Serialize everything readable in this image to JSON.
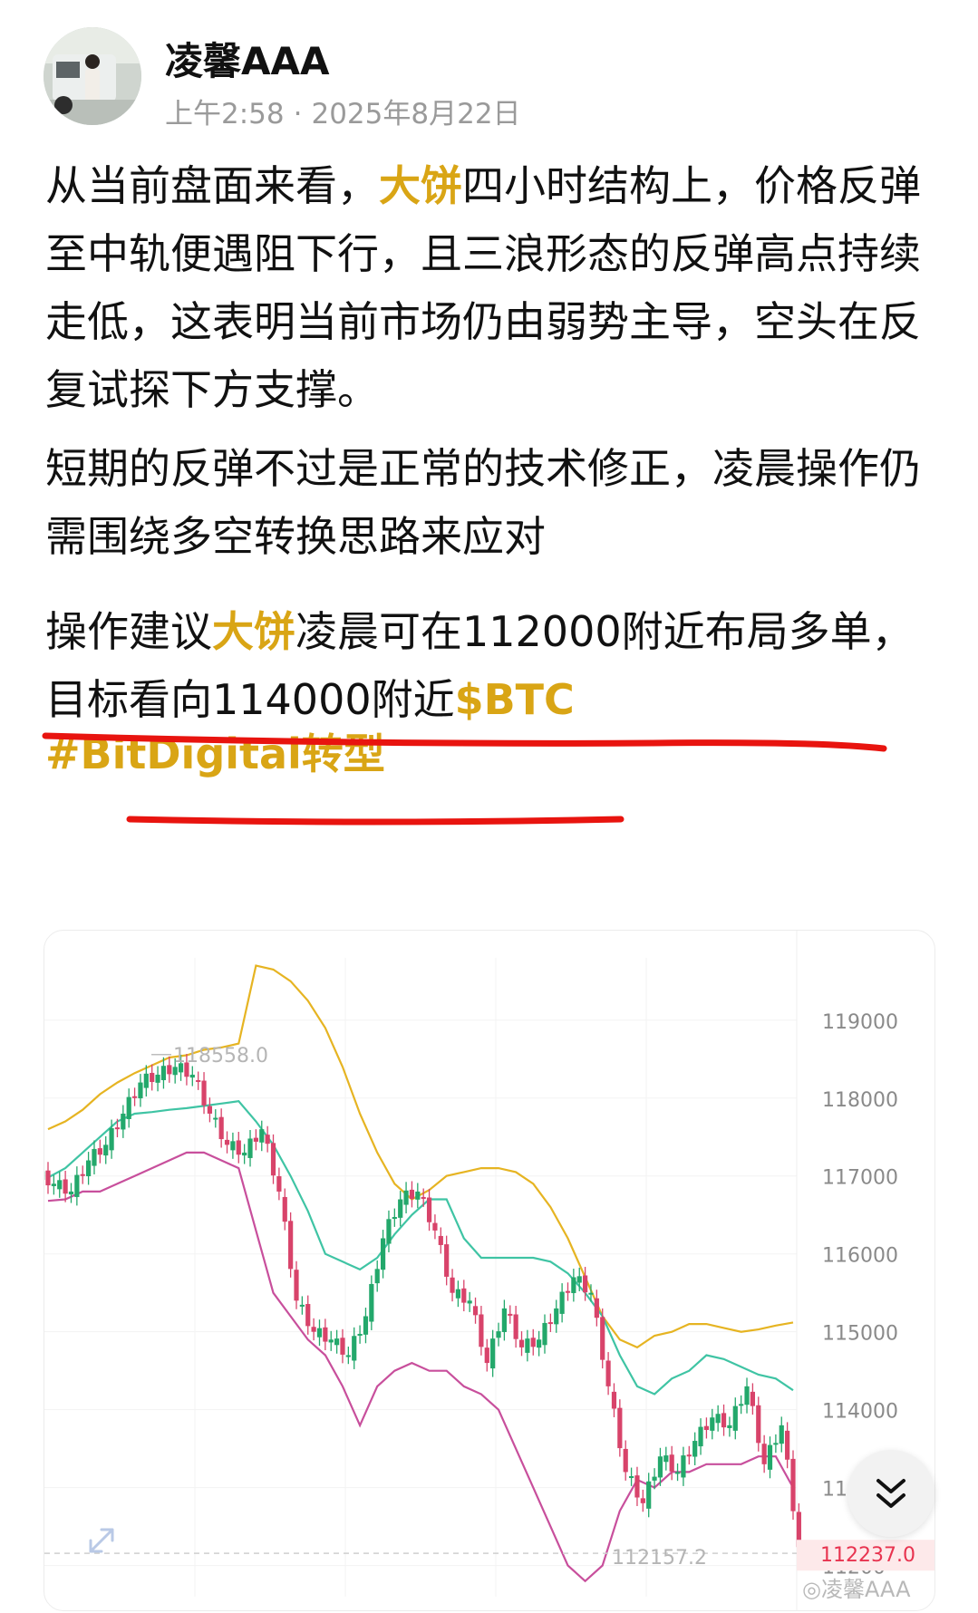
{
  "post": {
    "author": "凌馨AAA",
    "time": "上午2:58",
    "separator": "·",
    "date": "2025年8月22日"
  },
  "content": {
    "p1_a": "从当前盘面来看，",
    "p1_hl": "大饼",
    "p1_b": "四小时结构上，价格反弹至中轨便遇阻下行，且三浪形态的反弹高点持续走低，这表明当前市场仍由弱势主导，空头在反复试探下方支撑。",
    "p2": "短期的反弹不过是正常的技术修正，凌晨操作仍需围绕多空转换思路来应对",
    "p3_a": "操作建议",
    "p3_hl": "大饼",
    "p3_b": "凌晨可在112000附近布局多单，目标看向114000附近",
    "p3_tag": "$BTC",
    "hashtag": "#BitDigital转型"
  },
  "chart_data": {
    "type": "candlestick",
    "indicator": "bollinger-bands",
    "y_ticks": [
      119000,
      118000,
      117000,
      116000,
      115000,
      114000,
      113000,
      112000
    ],
    "y_tick_labels": [
      "119000",
      "118000",
      "117000",
      "116000",
      "115000",
      "114000",
      "113",
      "11200"
    ],
    "ylim": [
      111600,
      119800
    ],
    "high_marker": "118558.0",
    "low_marker": "112157.2",
    "current_price": "112237.0",
    "colors": {
      "up": "#23a86b",
      "down": "#d8436a",
      "upper": "#e6b422",
      "mid": "#3fc4a4",
      "lower": "#c84f9c",
      "price_tag": "#e8334f"
    },
    "upper_band": [
      117600,
      117700,
      117850,
      118050,
      118200,
      118320,
      118420,
      118520,
      118550,
      118620,
      118650,
      118700,
      119700,
      119650,
      119500,
      119250,
      118900,
      118400,
      117800,
      117300,
      116900,
      116700,
      116820,
      117000,
      117050,
      117100,
      117100,
      117050,
      116900,
      116600,
      116200,
      115700,
      115200,
      114900,
      114800,
      114950,
      115000,
      115100,
      115100,
      115050,
      115000,
      115030,
      115080,
      115120
    ],
    "mid_band": [
      116980,
      117100,
      117300,
      117500,
      117700,
      117800,
      117820,
      117850,
      117870,
      117900,
      117930,
      117960,
      117700,
      117400,
      117000,
      116550,
      116000,
      115900,
      115800,
      115950,
      116250,
      116500,
      116700,
      116700,
      116200,
      115950,
      115950,
      115950,
      115950,
      115900,
      115750,
      115500,
      115200,
      114700,
      114300,
      114200,
      114400,
      114500,
      114700,
      114650,
      114550,
      114450,
      114400,
      114250
    ],
    "lower_band": [
      116680,
      116700,
      116800,
      116800,
      116900,
      117000,
      117100,
      117200,
      117300,
      117300,
      117200,
      117100,
      116300,
      115500,
      115200,
      114900,
      114700,
      114300,
      113800,
      114300,
      114500,
      114600,
      114500,
      114500,
      114300,
      114200,
      114000,
      113500,
      113000,
      112500,
      112000,
      111800,
      112000,
      112700,
      113100,
      113000,
      113200,
      113200,
      113300,
      113300,
      113300,
      113400,
      113400,
      113000
    ],
    "close": [
      116900,
      116800,
      117200,
      117400,
      117800,
      118200,
      118300,
      118400,
      118300,
      117800,
      117400,
      117300,
      117600,
      116800,
      115400,
      115000,
      114900,
      114700,
      115200,
      116200,
      116700,
      116800,
      116300,
      115500,
      115400,
      114600,
      115300,
      114800,
      114900,
      115300,
      115700,
      115500,
      114300,
      113200,
      112800,
      113400,
      113200,
      113600,
      113900,
      113800,
      114300,
      113300,
      113800,
      112237
    ]
  }
}
